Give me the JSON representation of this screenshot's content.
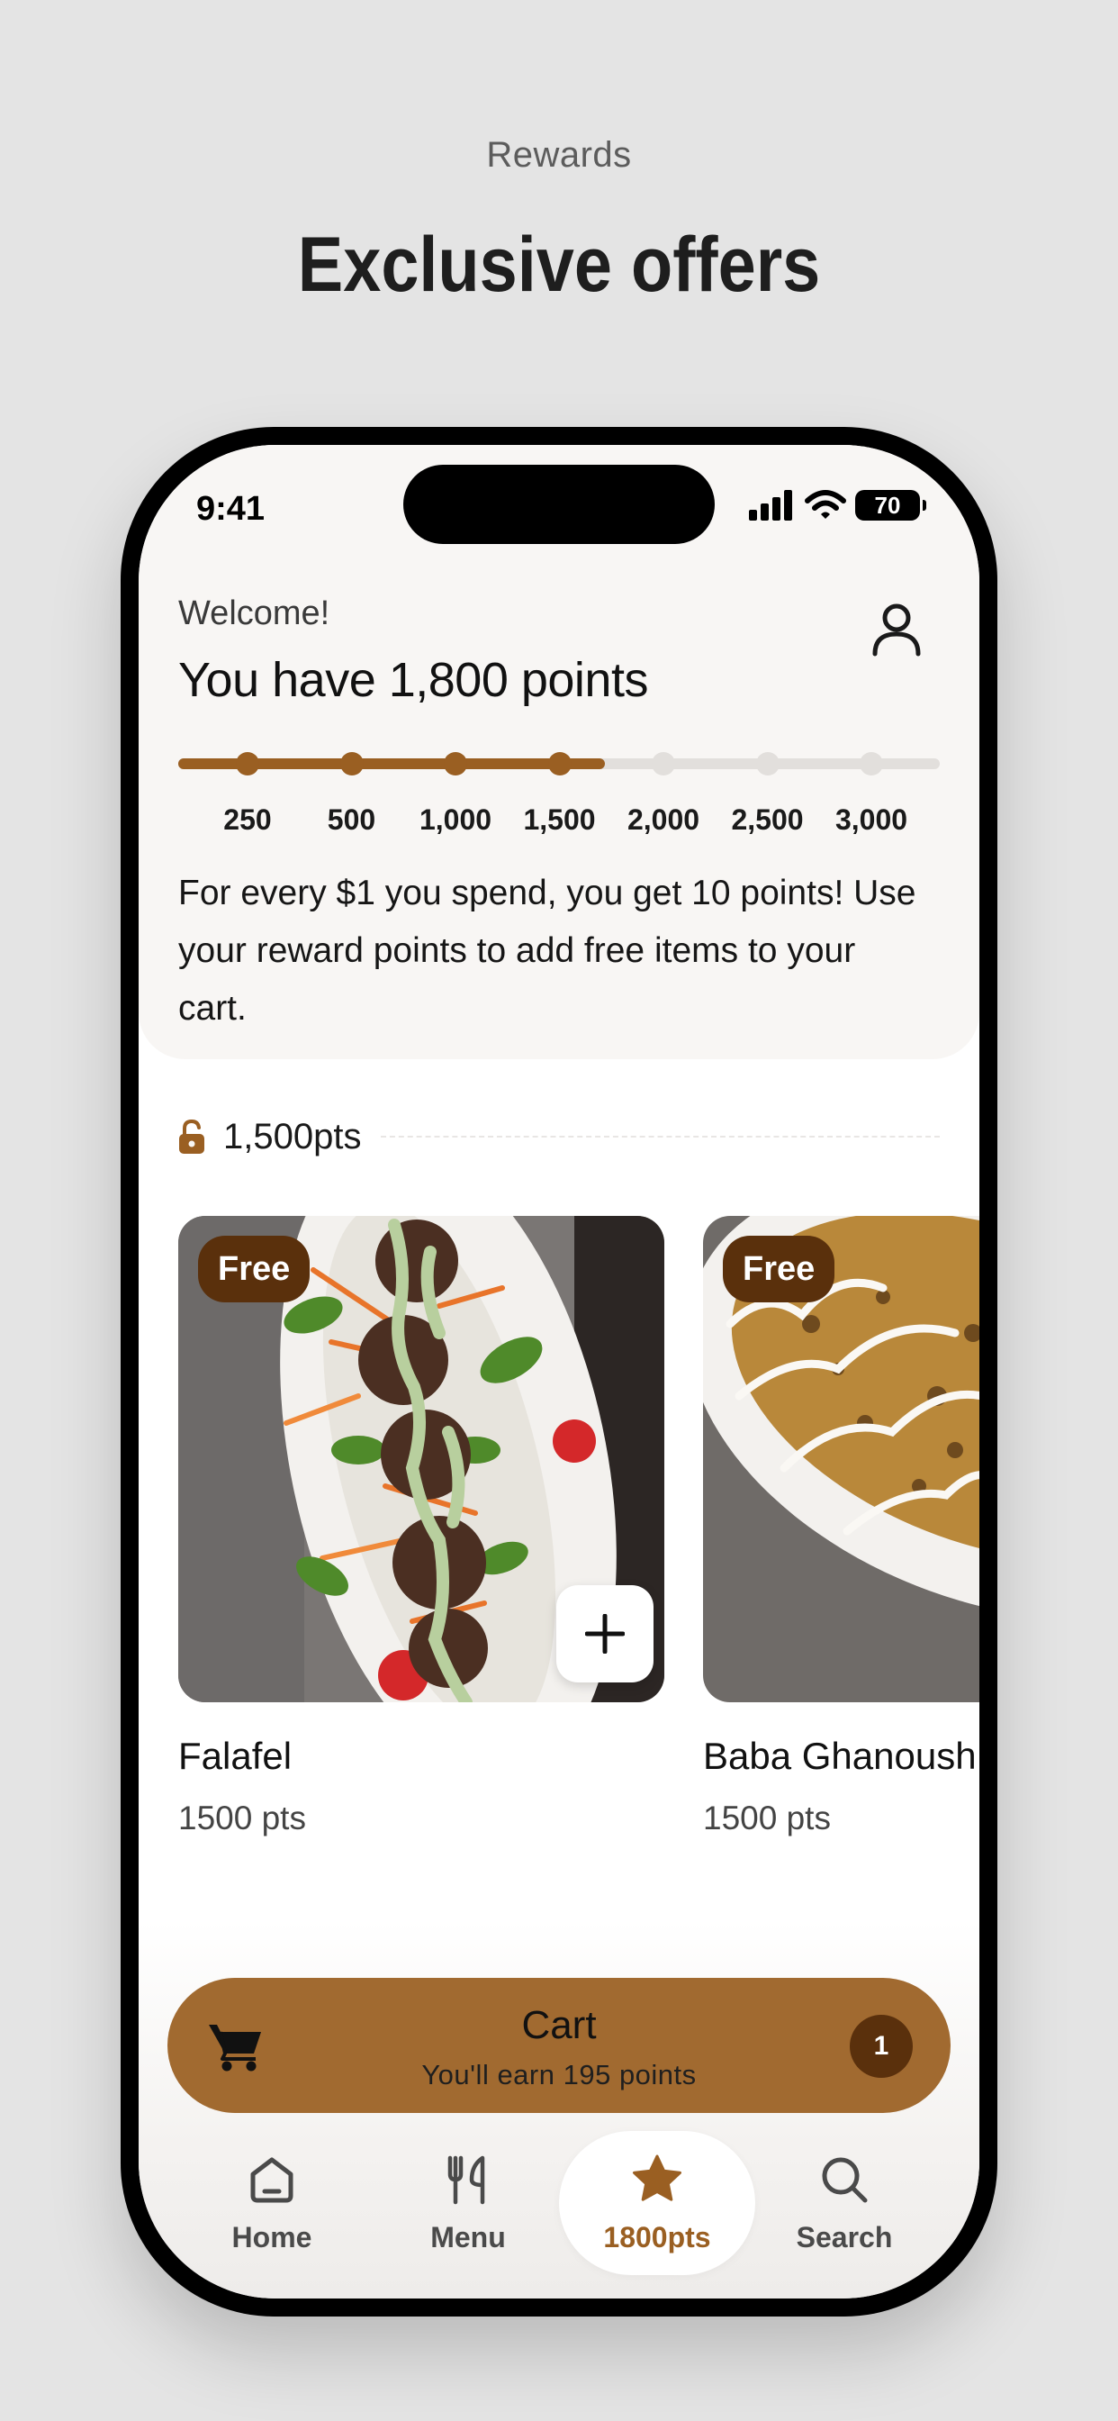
{
  "header": {
    "label": "Rewards",
    "title": "Exclusive offers"
  },
  "status_bar": {
    "time": "9:41",
    "battery": "70"
  },
  "rewards": {
    "welcome": "Welcome!",
    "points_title": "You have 1,800 points",
    "points": 1800,
    "progress_fraction": 0.56,
    "ticks": [
      "250",
      "500",
      "1,000",
      "1,500",
      "2,000",
      "2,500",
      "3,000"
    ],
    "ticks_reached": 4,
    "info": "For every $1 you spend, you get 10 points! Use your reward points to add free items to your cart."
  },
  "tier": {
    "label": "1,500pts",
    "icon": "unlock-icon"
  },
  "items": [
    {
      "badge": "Free",
      "name": "Falafel",
      "points": "1500 pts"
    },
    {
      "badge": "Free",
      "name": "Baba Ghanoush",
      "points": "1500 pts"
    }
  ],
  "cart": {
    "title": "Cart",
    "subtitle": "You'll earn 195 points",
    "count": "1"
  },
  "tabs": [
    {
      "label": "Home",
      "icon": "home-icon"
    },
    {
      "label": "Menu",
      "icon": "utensils-icon"
    },
    {
      "label": "1800pts",
      "icon": "star-icon"
    },
    {
      "label": "Search",
      "icon": "search-icon"
    }
  ],
  "colors": {
    "accent": "#9a5f22",
    "cart": "#a16a30",
    "badge": "#5a300c",
    "background": "#e4e4e4"
  }
}
